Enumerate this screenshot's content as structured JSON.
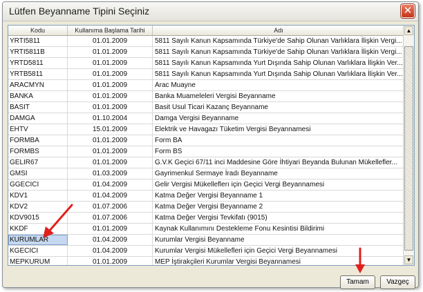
{
  "dialog": {
    "title": "Lütfen Beyanname Tipini Seçiniz",
    "close_glyph": "✕"
  },
  "table": {
    "columns": [
      "Kodu",
      "Kullanıma Başlama Tarihi",
      "Adı"
    ],
    "rows": [
      {
        "kodu": "YRTI5811",
        "tarih": "01.01.2009",
        "adi": "5811 Sayılı Kanun Kapsamında Türkiye'de Sahip Olunan Varlıklara İlişkin Vergi..."
      },
      {
        "kodu": "YRTI5811B",
        "tarih": "01.01.2009",
        "adi": "5811 Sayılı Kanun Kapsamında Türkiye'de Sahip Olunan Varlıklara İlişkin Vergi..."
      },
      {
        "kodu": "YRTD5811",
        "tarih": "01.01.2009",
        "adi": "5811 Sayılı Kanun Kapsamında Yurt Dışında Sahip Olunan Varlıklara İlişkin Ver..."
      },
      {
        "kodu": "YRTB5811",
        "tarih": "01.01.2009",
        "adi": "5811 Sayılı Kanun Kapsamında Yurt Dışında Sahip Olunan Varlıklara İlişkin Ver..."
      },
      {
        "kodu": "ARACMYN",
        "tarih": "01.01.2009",
        "adi": "Arac Muayne"
      },
      {
        "kodu": "BANKA",
        "tarih": "01.01.2009",
        "adi": "Banka Muameleleri Vergisi Beyanname"
      },
      {
        "kodu": "BASIT",
        "tarih": "01.01.2009",
        "adi": "Basit Usul Ticari Kazanç Beyanname"
      },
      {
        "kodu": "DAMGA",
        "tarih": "01.10.2004",
        "adi": "Damga Vergisi Beyanname"
      },
      {
        "kodu": "EHTV",
        "tarih": "15.01.2009",
        "adi": "Elektrik ve Havagazı Tüketim Vergisi Beyannamesi"
      },
      {
        "kodu": "FORMBA",
        "tarih": "01.01.2009",
        "adi": "Form BA"
      },
      {
        "kodu": "FORMBS",
        "tarih": "01.01.2009",
        "adi": "Form BS"
      },
      {
        "kodu": "GELIR67",
        "tarih": "01.01.2009",
        "adi": "G.V.K Geçici 67/11 inci Maddesine Göre İhtiyari Beyanda Bulunan Mükellefler..."
      },
      {
        "kodu": "GMSI",
        "tarih": "01.03.2009",
        "adi": "Gayrimenkul Sermaye İradı Beyanname"
      },
      {
        "kodu": "GGECICI",
        "tarih": "01.04.2009",
        "adi": "Gelir Vergisi Mükelleflerı için Geçici Vergi Beyannamesi"
      },
      {
        "kodu": "KDV1",
        "tarih": "01.04.2009",
        "adi": "Katma Değer Vergisi Beyanname 1"
      },
      {
        "kodu": "KDV2",
        "tarih": "01.07.2006",
        "adi": "Katma Değer Vergisi Beyanname 2"
      },
      {
        "kodu": "KDV9015",
        "tarih": "01.07.2006",
        "adi": "Katma Değer Vergisi Tevkifatı (9015)"
      },
      {
        "kodu": "KKDF",
        "tarih": "01.01.2009",
        "adi": "Kaynak Kullanımını Destekleme Fonu Kesintisi Bildirimi"
      },
      {
        "kodu": "KURUMLAR",
        "tarih": "01.04.2009",
        "adi": "Kurumlar Vergisi Beyanname"
      },
      {
        "kodu": "KGECICI",
        "tarih": "01.04.2009",
        "adi": "Kurumlar Vergisi Mükellefleri için Geçici Vergi Beyannamesi"
      },
      {
        "kodu": "MEPKURUM",
        "tarih": "01.01.2009",
        "adi": "MEP İştirakçileri Kurumlar Vergisi Beyannamesi"
      }
    ],
    "selected_kodu": "KURUMLAR"
  },
  "scrollbar": {
    "up_glyph": "▲",
    "down_glyph": "▼"
  },
  "buttons": {
    "ok_label": "Tamam",
    "cancel_label": "Vazgeç"
  },
  "colors": {
    "annotation_arrow": "#e0201b",
    "selection": "#c6d8ef"
  }
}
